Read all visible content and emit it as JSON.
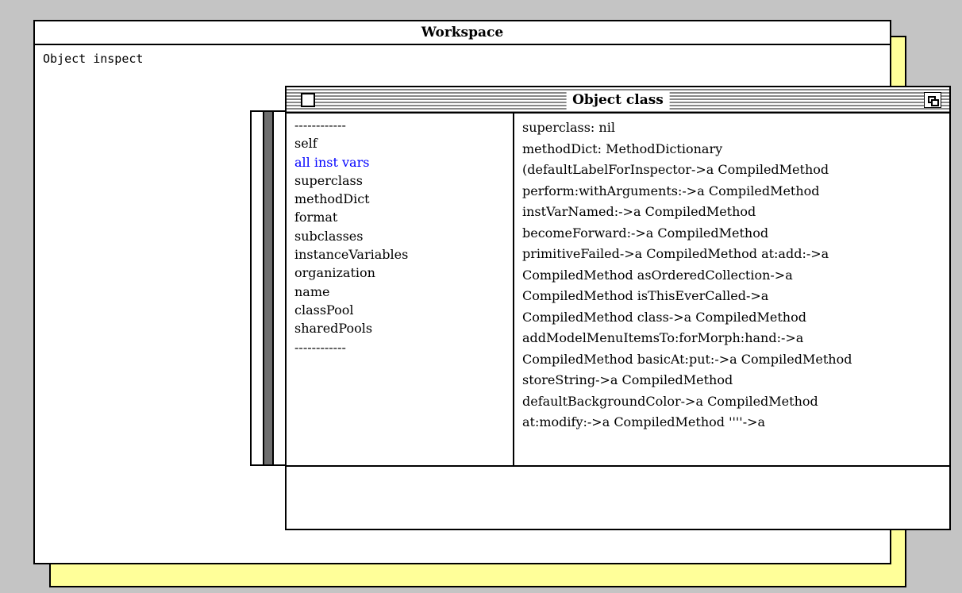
{
  "workspace": {
    "title": "Workspace",
    "text": "Object inspect"
  },
  "inspector": {
    "title": "Object class",
    "icons": {
      "close": "close-box-icon",
      "collapse": "collapse-window-icon"
    },
    "fields": [
      "------------",
      "self",
      "all inst vars",
      "superclass",
      "methodDict",
      "format",
      "subclasses",
      "instanceVariables",
      "organization",
      "name",
      "classPool",
      "sharedPools",
      "------------"
    ],
    "selected_field": "all inst vars",
    "value_lines": [
      "superclass:  nil",
      "methodDict:  MethodDictionary",
      "(defaultLabelForInspector->a CompiledMethod",
      "perform:withArguments:->a CompiledMethod",
      "instVarNamed:->a CompiledMethod",
      "becomeForward:->a CompiledMethod",
      "primitiveFailed->a CompiledMethod at:add:->a",
      "CompiledMethod asOrderedCollection->a",
      "CompiledMethod isThisEverCalled->a",
      "CompiledMethod class->a CompiledMethod",
      "addModelMenuItemsTo:forMorph:hand:->a",
      "CompiledMethod basicAt:put:->a CompiledMethod",
      "storeString->a CompiledMethod",
      "defaultBackgroundColor->a CompiledMethod",
      "at:modify:->a CompiledMethod ''''->a"
    ],
    "eval_text": ""
  },
  "colors": {
    "desktop": "#c4c4c4",
    "window_back": "#ffff99",
    "selection": "#0000ff",
    "scrollbar": "#6e6e6e"
  }
}
